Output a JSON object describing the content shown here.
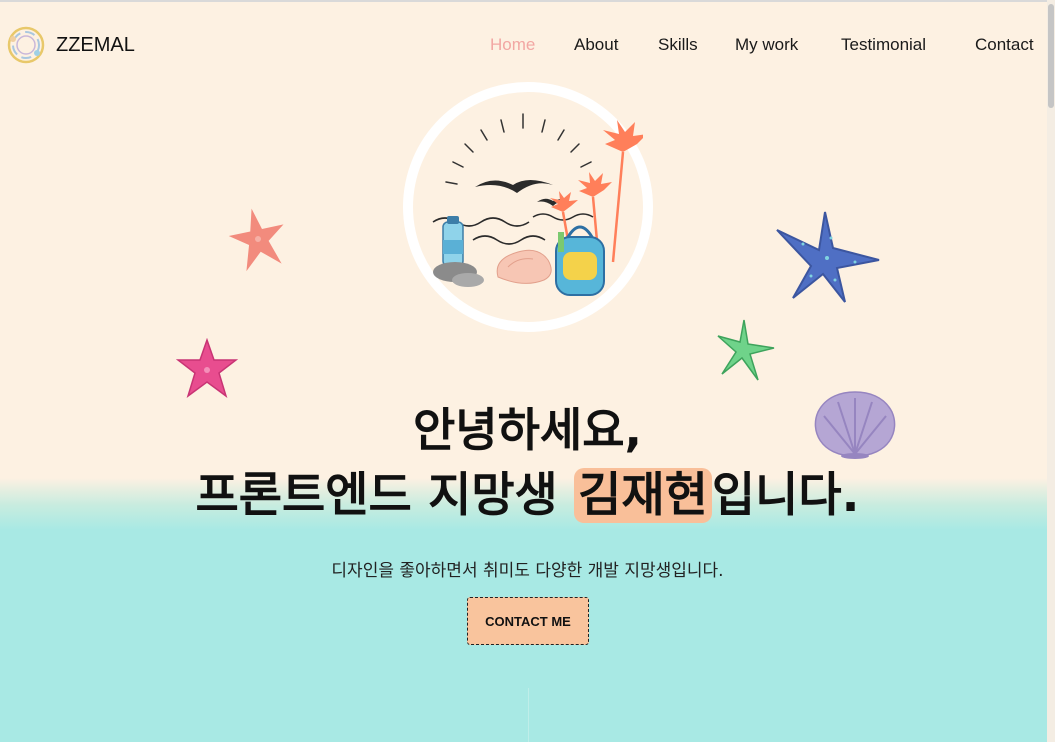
{
  "brand": {
    "name": "ZZEMAL",
    "icon": "ring-logo-icon"
  },
  "nav": {
    "items": [
      {
        "label": "Home",
        "active": true
      },
      {
        "label": "About",
        "active": false
      },
      {
        "label": "Skills",
        "active": false
      },
      {
        "label": "My work",
        "active": false
      },
      {
        "label": "Testimonial",
        "active": false
      },
      {
        "label": "Contact",
        "active": false
      }
    ]
  },
  "hero": {
    "line1": "안녕하세요,",
    "line2_before": "프론트엔드 지망생 ",
    "line2_highlight": "김재현",
    "line2_after": "입니다.",
    "subtitle": "디자인을 좋아하면서 취미도 다양한 개발 지망생입니다.",
    "cta_label": "CONTACT ME",
    "illustration": "beach-travel-illustration"
  },
  "colors": {
    "background_top": "#fdf1e2",
    "background_bottom": "#a8e9e4",
    "accent": "#f9bf99",
    "nav_active": "#f2a7a3"
  },
  "decorations": [
    "coral-starfish-icon",
    "blue-starfish-icon",
    "pink-starfish-icon",
    "green-starfish-icon",
    "seashell-icon"
  ]
}
